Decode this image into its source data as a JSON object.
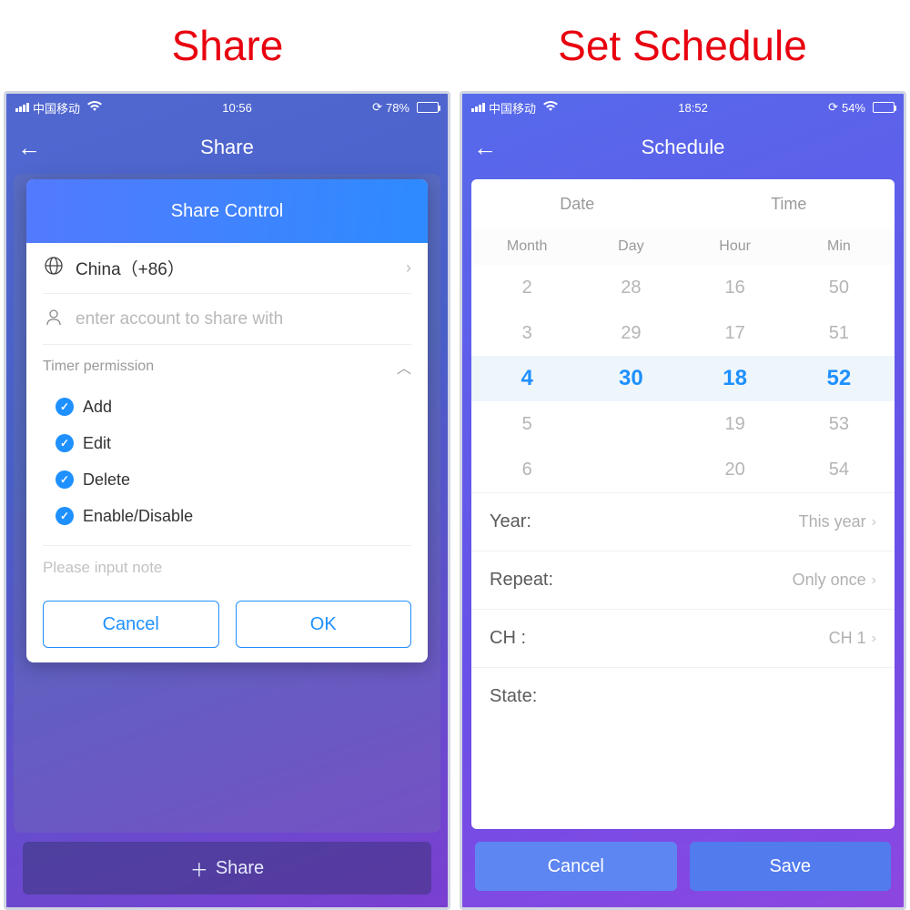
{
  "titles": {
    "left": "Share",
    "right": "Set Schedule"
  },
  "share": {
    "status": {
      "carrier": "中国移动",
      "time": "10:56",
      "battery_pct": "78%"
    },
    "header": "Share",
    "modal": {
      "title": "Share Control",
      "country": "China（+86）",
      "account_placeholder": "enter account to share with",
      "timer_section": "Timer permission",
      "perms": [
        "Add",
        "Edit",
        "Delete",
        "Enable/Disable"
      ],
      "note_placeholder": "Please input note",
      "cancel": "Cancel",
      "ok": "OK"
    },
    "footer_button": "Share"
  },
  "schedule": {
    "status": {
      "carrier": "中国移动",
      "time": "18:52",
      "battery_pct": "54%"
    },
    "header": "Schedule",
    "tabs": {
      "date": "Date",
      "time": "Time"
    },
    "picker": {
      "headers": [
        "Month",
        "Day",
        "Hour",
        "Min"
      ],
      "month": [
        "2",
        "3",
        "4",
        "5",
        "6"
      ],
      "day": [
        "28",
        "29",
        "30",
        "",
        ""
      ],
      "hour": [
        "16",
        "17",
        "18",
        "19",
        "20"
      ],
      "min": [
        "50",
        "51",
        "52",
        "53",
        "54"
      ]
    },
    "rows": {
      "year_label": "Year:",
      "year_value": "This year",
      "repeat_label": "Repeat:",
      "repeat_value": "Only once",
      "ch_label": "CH :",
      "ch_value": "CH 1",
      "state_label": "State:"
    },
    "buttons": {
      "cancel": "Cancel",
      "save": "Save"
    }
  }
}
